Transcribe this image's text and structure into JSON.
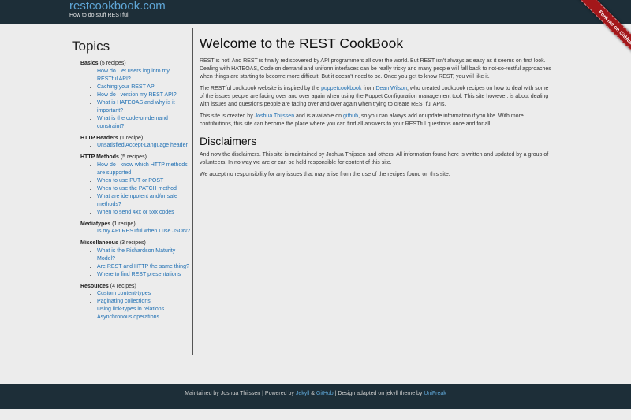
{
  "header": {
    "site_title": "restcookbook.com",
    "tagline": "How to do stuff RESTful",
    "ribbon": "Fork me on GitHub"
  },
  "sidebar": {
    "title": "Topics",
    "categories": [
      {
        "name": "Basics",
        "count": "(5 recipes)",
        "items": [
          "How do I let users log into my RESTful API?",
          "Caching your REST API",
          "How do I version my REST API?",
          "What is HATEOAS and why is it important?",
          "What is the code-on-demand constraint?"
        ]
      },
      {
        "name": "HTTP Headers",
        "count": "(1 recipe)",
        "items": [
          "Unsatisfied Accept-Language header"
        ]
      },
      {
        "name": "HTTP Methods",
        "count": "(5 recipes)",
        "items": [
          "How do I know which HTTP methods are supported",
          "When to use PUT or POST",
          "When to use the PATCH method",
          "What are idempotent and/or safe methods?",
          "When to send 4xx or 5xx codes"
        ]
      },
      {
        "name": "Mediatypes",
        "count": "(1 recipe)",
        "items": [
          "Is my API RESTful when I use JSON?"
        ]
      },
      {
        "name": "Miscellaneous",
        "count": "(3 recipes)",
        "items": [
          "What is the Richardson Maturity Model?",
          "Are REST and HTTP the same thing?",
          "Where to find REST presentations"
        ]
      },
      {
        "name": "Resources",
        "count": "(4 recipes)",
        "items": [
          "Custom content-types",
          "Paginating collections",
          "Using link-types in relations",
          "Asynchronous operations"
        ]
      }
    ]
  },
  "main": {
    "title": "Welcome to the REST CookBook",
    "p1": "REST is hot! And REST is finally rediscovered by API programmers all over the world. But REST isn't always as easy as it seems on first look. Dealing with HATEOAS, Code on demand and uniform interfaces can be really tricky and many people will fall back to not-so-restful approaches when things are starting to become more difficult. But it doesn't need to be. Once you get to know REST, you will like it.",
    "p2": {
      "t1": "The RESTful cookbook website is inspired by the ",
      "link1": "puppetcookbook",
      "t2": " from ",
      "link2": "Dean Wilson",
      "t3": ", who created cookbook recipes on how to deal with some of the issues people are facing over and over again when using the Puppet Configuration management tool. This site however, is about dealing with issues and questions people are facing over and over again when trying to create RESTful APIs."
    },
    "p3": {
      "t1": "This site is created by ",
      "link1": "Joshua Thijssen",
      "t2": " and is available on ",
      "link2": "github",
      "t3": ", so you can always add or update information if you like. With more contributions, this site can become the place where you can find all answers to your RESTful questions once and for all."
    },
    "disclaimers_title": "Disclaimers",
    "d1": "And now the disclaimers. This site is maintained by Joshua Thijssen and others. All information found here is written and updated by a group of volunteers. In no way we are or can be held responsible for content of this site.",
    "d2": "We accept no responsibility for any issues that may arise from the use of the recipes found on this site."
  },
  "footer": {
    "t1": "Maintained by Joshua Thijssen | Powered by ",
    "jekyll": "Jekyll",
    "amp": " & ",
    "github": "GitHub",
    "t2": " | Design adapted on jekyll theme by ",
    "unifreak": "UniFreak"
  }
}
